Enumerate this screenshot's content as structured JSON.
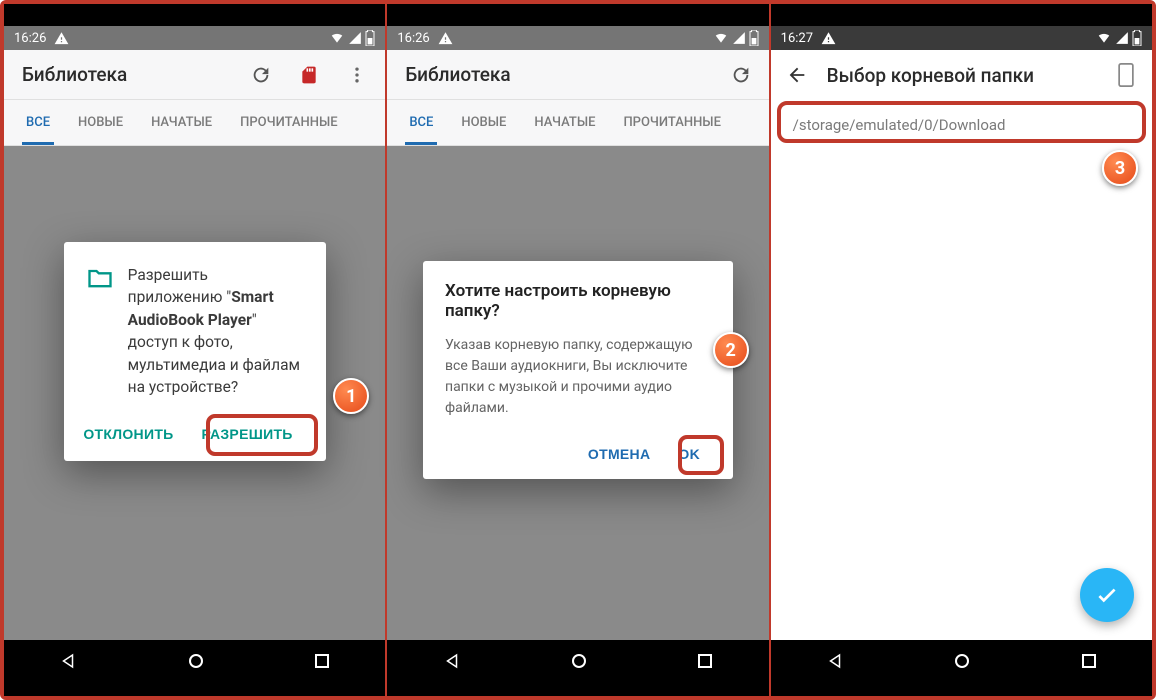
{
  "status": {
    "time1": "16:26",
    "time2": "16:26",
    "time3": "16:27"
  },
  "appbar": {
    "title": "Библиотека"
  },
  "tabs": {
    "all": "ВСЕ",
    "new": "НОВЫЕ",
    "started": "НАЧАТЫЕ",
    "read": "ПРОЧИТАННЫЕ"
  },
  "perm": {
    "pre": "Разрешить приложению \"",
    "app": "Smart AudioBook Player",
    "post": "\" доступ к фото, мультимедиа и файлам на устройстве?",
    "deny": "ОТКЛОНИТЬ",
    "allow": "РАЗРЕШИТЬ"
  },
  "root": {
    "title": "Хотите настроить корневую папку?",
    "text": "Указав корневую папку, содержащую все Ваши аудиокниги, Вы исключите папки с музыкой и прочими аудио файлами.",
    "cancel": "ОТМЕНА",
    "ok": "OK"
  },
  "picker": {
    "title": "Выбор корневой папки",
    "path": "/storage/emulated/0/Download"
  },
  "markers": {
    "m1": "1",
    "m2": "2",
    "m3": "3"
  }
}
